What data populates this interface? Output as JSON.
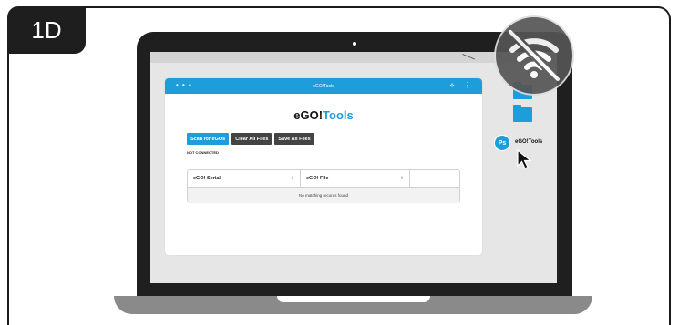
{
  "step_badge": "1D",
  "app": {
    "window_title": "eGO!Tools",
    "heading_prefix": "eGO!",
    "heading_accent": "Tools",
    "buttons": [
      "Scan for eGOs",
      "Clear All Files",
      "Save All Files"
    ],
    "connection_status": "NOT CONNECTED",
    "table": {
      "columns": [
        "eGO! Serial",
        "eGO! File"
      ],
      "empty_message": "No matching records found"
    }
  },
  "desktop": {
    "app_icon_glyph": "Ps",
    "app_icon_label": "eGO!Tools"
  },
  "icons": {
    "overlay": "wifi-off-icon",
    "pointer": "cursor-arrow-icon",
    "window_controls": "dots-menu-icon",
    "extension": "puzzle-icon",
    "kebab": "kebab-menu-icon",
    "folder": "folder-icon"
  },
  "colors": {
    "accent": "#1e9ddb",
    "dark_button": "#444444",
    "overlay": "#555555"
  }
}
